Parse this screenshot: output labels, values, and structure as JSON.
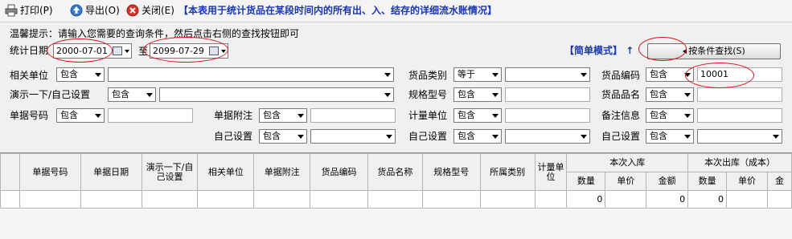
{
  "toolbar": {
    "print_label": "打印(P)",
    "export_label": "导出(O)",
    "close_label": "关闭(E)",
    "notice": "【本表用于统计货品在某段时间内的所有出、入、结存的详细流水账情况】"
  },
  "hint": "温馨提示：请输入您需要的查询条件，然后点击右侧的查找按钮即可",
  "date_range": {
    "label": "统计日期",
    "start": "2000-07-01",
    "to_label": "至",
    "end": "2099-07-29"
  },
  "mode_link": "【简单模式】",
  "mode_arrow": "↑",
  "search_button": "按条件查找(S)",
  "filters": {
    "related_unit": {
      "label": "相关单位",
      "op": "包含",
      "value": ""
    },
    "demo_setting": {
      "label": "演示一下/自己设置",
      "op": "包含",
      "value": ""
    },
    "doc_number": {
      "label": "单据号码",
      "op": "包含",
      "value": ""
    },
    "doc_note": {
      "label": "单据附注",
      "op": "包含",
      "value": ""
    },
    "custom1": {
      "label": "自己设置",
      "op": "包含",
      "value": ""
    },
    "category": {
      "label": "货品类别",
      "op": "等于",
      "value": ""
    },
    "model": {
      "label": "规格型号",
      "op": "包含",
      "value": ""
    },
    "unit": {
      "label": "计量单位",
      "op": "包含",
      "value": ""
    },
    "custom2": {
      "label": "自己设置",
      "op": "包含",
      "value": ""
    },
    "item_code": {
      "label": "货品编码",
      "op": "包含",
      "value": "10001"
    },
    "item_name": {
      "label": "货品品名",
      "op": "包含",
      "value": ""
    },
    "remark": {
      "label": "备注信息",
      "op": "包含",
      "value": ""
    },
    "custom3": {
      "label": "自己设置",
      "op": "包含",
      "value": ""
    }
  },
  "grid": {
    "headers": [
      "单据号码",
      "单据日期",
      "演示一下/自己设置",
      "相关单位",
      "单据附注",
      "货品编码",
      "货品名称",
      "规格型号",
      "所属类别",
      "计量单位"
    ],
    "group_in": "本次入库",
    "group_out": "本次出库（成本）",
    "sub_in": [
      "数量",
      "单价",
      "金额"
    ],
    "sub_out": [
      "数量",
      "单价",
      "金"
    ],
    "row": [
      "",
      "",
      "",
      "",
      "",
      "",
      "",
      "",
      "",
      "",
      "0",
      "",
      "0",
      "0",
      "",
      ""
    ]
  },
  "colors": {
    "accent": "#1a36b0",
    "annotation": "#d4141e"
  }
}
